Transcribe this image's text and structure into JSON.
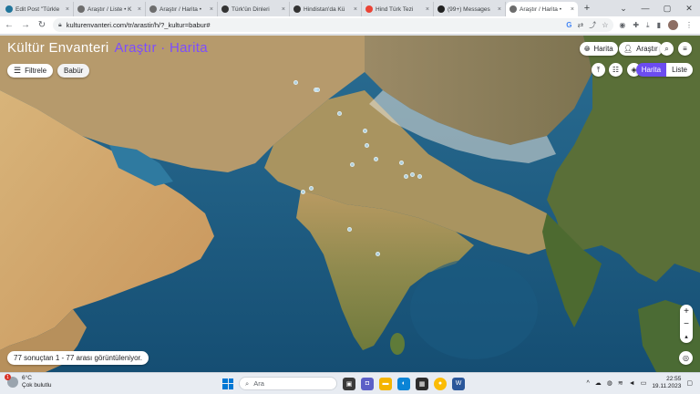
{
  "browser": {
    "tabs": [
      {
        "label": "Edit Post \"Türkle",
        "icon": "wordpress-icon",
        "color": "#21759b",
        "active": false
      },
      {
        "label": "Araştır / Liste • K",
        "icon": "kultur-icon",
        "color": "#6d6d6d",
        "active": false
      },
      {
        "label": "Araştır / Harita •",
        "icon": "kultur-icon",
        "color": "#6d6d6d",
        "active": false
      },
      {
        "label": "Türk'ün Dinleri",
        "icon": "b-icon",
        "color": "#333333",
        "active": false
      },
      {
        "label": "Hindistan'da Kü",
        "icon": "b-icon",
        "color": "#333333",
        "active": false
      },
      {
        "label": "Hind Türk Tezi",
        "icon": "gmail-icon",
        "color": "#ea4335",
        "active": false
      },
      {
        "label": "(99+) Messages",
        "icon": "a-icon",
        "color": "#222222",
        "active": false
      },
      {
        "label": "Araştır / Harita •",
        "icon": "kultur-icon",
        "color": "#6d6d6d",
        "active": true
      }
    ],
    "close_glyph": "×",
    "newtab_glyph": "+",
    "url": "kulturenvanteri.com/tr/arastir/h/?_kultur=babur#",
    "winctl": [
      "⌄",
      "—",
      "▢",
      "✕"
    ]
  },
  "map": {
    "title": "Kültür Envanteri",
    "title_sub": "Araştır · Harita",
    "filter_label": "Filtrele",
    "tag_label": "Babür",
    "harita_btn": "Harita",
    "arastir_btn": "Araştır",
    "seg_on": "Harita",
    "seg_off": "Liste",
    "zoom_in": "+",
    "zoom_out": "−",
    "compass": "▴",
    "results": "77 sonuçtan 1 - 77 arası görüntüleniyor."
  },
  "taskbar": {
    "temp": "6°C",
    "weather": "Çok bulutlu",
    "badge": "1",
    "search_placeholder": "Ara",
    "time": "22:55",
    "date": "19.11.2023"
  },
  "colors": {
    "accent": "#6c4cf1",
    "ocean": "#1d5f86",
    "land": "#c9a96e",
    "forest": "#4b6b34"
  }
}
